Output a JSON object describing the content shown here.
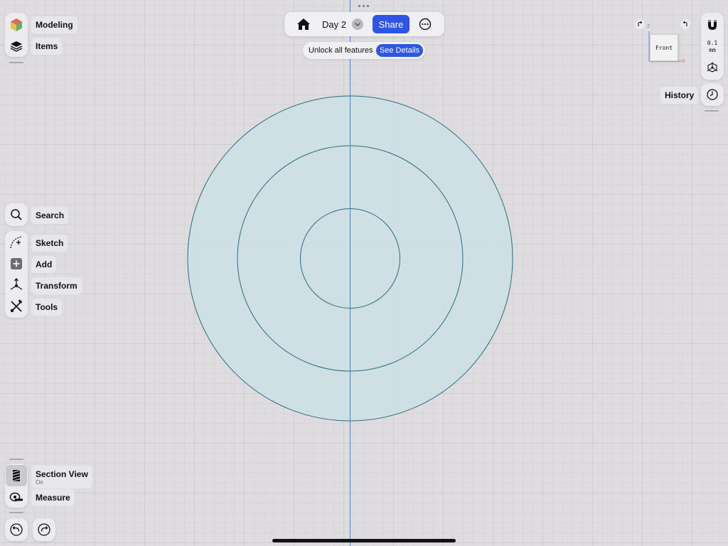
{
  "topbar": {
    "doc_title": "Day 2",
    "share_label": "Share",
    "unlock_text": "Unlock all features",
    "details_label": "See Details"
  },
  "left_top": {
    "modeling_label": "Modeling",
    "items_label": "Items"
  },
  "left_tools": {
    "search_label": "Search",
    "sketch_label": "Sketch",
    "add_label": "Add",
    "transform_label": "Transform",
    "tools_label": "Tools"
  },
  "left_bottom": {
    "section_label": "Section View",
    "section_status": "On",
    "measure_label": "Measure"
  },
  "right": {
    "history_label": "History",
    "grid_value": "0.1",
    "grid_unit": "mm",
    "view_label": "Front",
    "axis_z": "Z",
    "axis_x": "X"
  },
  "colors": {
    "accent": "#2f55e4",
    "fill": "#cde0e6",
    "outline": "#2a6c7c",
    "axis": "#4a7fd0"
  }
}
